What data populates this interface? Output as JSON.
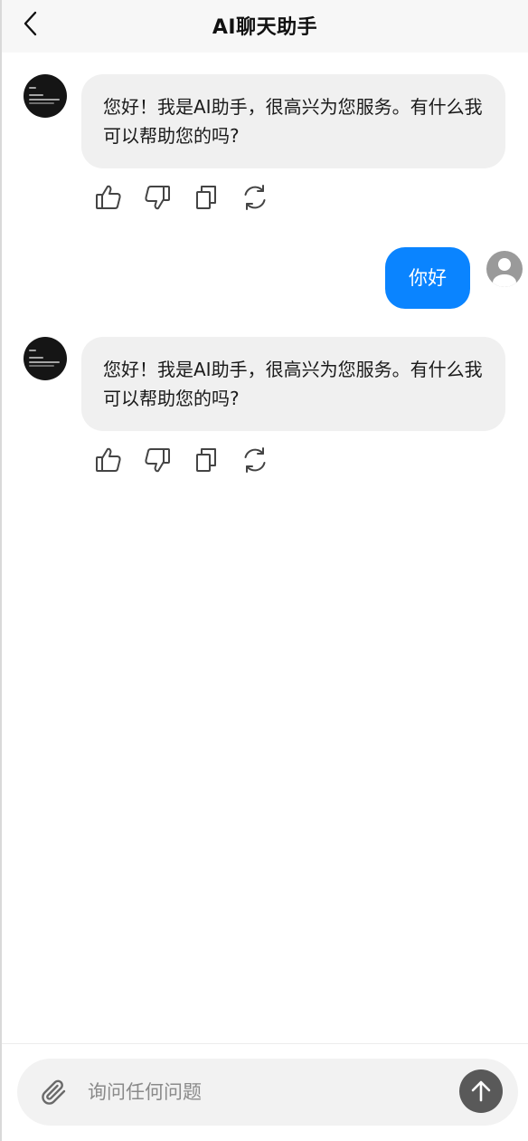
{
  "header": {
    "title": "AI聊天助手",
    "back_icon": "chevron-left-icon"
  },
  "messages": [
    {
      "role": "assistant",
      "text": "您好！我是AI助手，很高兴为您服务。有什么我可以帮助您的吗?",
      "actions": [
        "thumbs-up-icon",
        "thumbs-down-icon",
        "copy-icon",
        "refresh-icon"
      ]
    },
    {
      "role": "user",
      "text": "你好",
      "avatar_icon": "user-circle-icon"
    },
    {
      "role": "assistant",
      "text": "您好！我是AI助手，很高兴为您服务。有什么我可以帮助您的吗?",
      "actions": [
        "thumbs-up-icon",
        "thumbs-down-icon",
        "copy-icon",
        "refresh-icon"
      ]
    }
  ],
  "composer": {
    "placeholder": "询问任何问题",
    "value": "",
    "attach_icon": "paperclip-icon",
    "send_icon": "arrow-up-icon"
  },
  "colors": {
    "user_bubble": "#0a84ff",
    "assistant_bubble": "#f0f0f0",
    "send_button": "#595959",
    "header_bg": "#f7f7f7"
  }
}
